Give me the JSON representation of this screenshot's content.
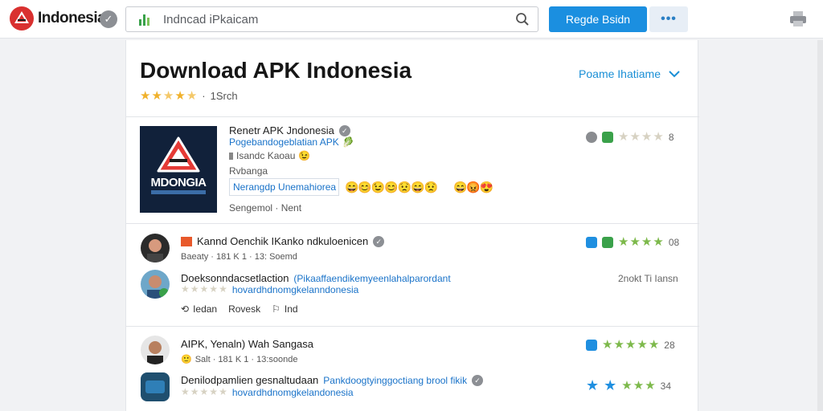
{
  "header": {
    "brand": "Indonesia",
    "search_placeholder": "Indncad iPkaicam",
    "primary_button": "Regde Bsidn",
    "more_button": "•••"
  },
  "page": {
    "title": "Download APK Indonesia",
    "rating_text": "1Srch",
    "filter_label": "Poame Ihatiame"
  },
  "featured": {
    "name": "Renetr APK Jndonesia",
    "link": "Pogebandogeblatian APK",
    "meta": "Isandc Kaoau",
    "category": "Rvbanga",
    "tag": "Nerangdp Unemahiorea",
    "developer": "Sengemol · Nent",
    "icon_wordmark": "MDONGIA",
    "stat": "8"
  },
  "rows": [
    {
      "title": "Kannd Oenchik IKanko ndkuloenicen",
      "meta": "Baeaty · 181 K 1 · 13: Soemd",
      "stat": "08",
      "sub_title": "Doeksonndacsetlaction",
      "sub_link_a": "(Pikaaffaendikemyeenlahalparordant",
      "sub_link_b": "hovardhdnomgkelanndonesia",
      "side_text": "2nokt Ti Iansn",
      "actions": [
        "Iedan",
        "Rovesk",
        "Ind"
      ]
    },
    {
      "title": "AIPK, Yenaln) Wah Sangasa",
      "meta": "Salt · 181 K 1 · 13:soonde",
      "stat": "28",
      "sub_title": "Denilodpamlien gesnaltudaan",
      "sub_link_a": "Pankdoogtyinggoctiang brool fikik",
      "sub_link_b": "hovardhdnomgkelandonesia",
      "stat2": "34"
    }
  ],
  "colors": {
    "accent": "#1b8fe0",
    "link": "#1a73c9",
    "star": "#f0b12b",
    "star_green": "#7db94b",
    "brand_red": "#d9302f"
  }
}
